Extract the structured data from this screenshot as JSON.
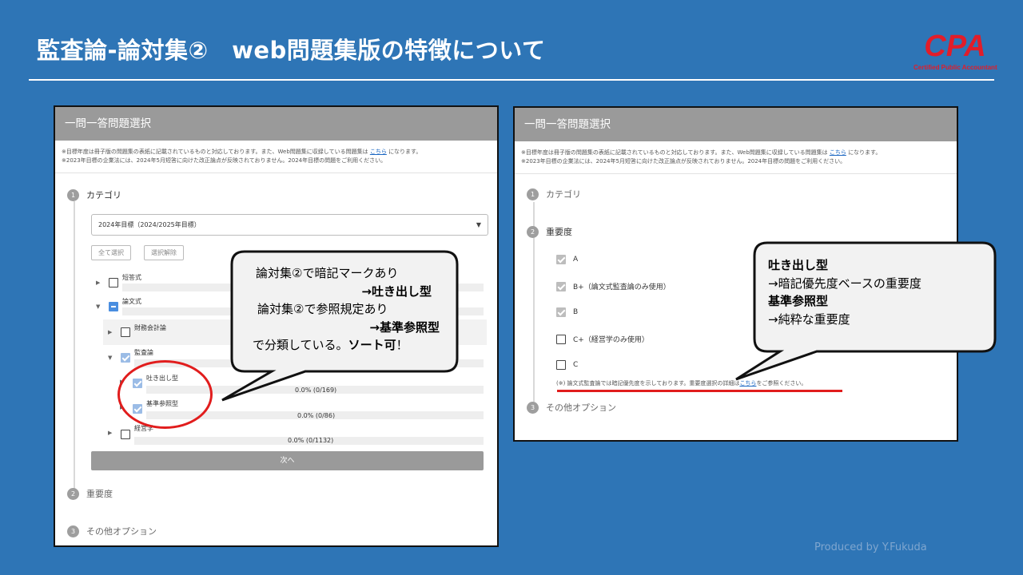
{
  "slide": {
    "title": "監査論-論対集②　web問題集版の特徴について",
    "logo_text": "CPA",
    "logo_sub": "Certified Public Accountant",
    "footer": "Produced by Y.Fukuda"
  },
  "left_panel": {
    "header": "一問一答問題選択",
    "note_line1_before": "※目標年度は冊子版の問題集の表紙に記載されているものと対応しております。また、Web問題集に収録している問題集は",
    "note_link": "こちら",
    "note_line1_after": "になります。",
    "note_line2": "※2023年目標の企業法には、2024年5月短答に向けた改正論点が反映されておりません。2024年目標の問題をご利用ください。",
    "step1": {
      "num": "1",
      "label": "カテゴリ"
    },
    "select_value": "2024年目標（2024/2025年目標）",
    "select_all": "全て選択",
    "deselect_all": "選択解除",
    "tree": {
      "short_answer": "短答式",
      "essay": "論文式",
      "financial_accounting": "財務会計論",
      "auditing": "監査論",
      "memorize_type": "吐き出し型",
      "memorize_progress": "0.0% (0/169)",
      "reference_type": "基準参照型",
      "reference_progress": "0.0% (0/86)",
      "management": "経営学",
      "management_progress": "0.0% (0/1132)"
    },
    "next_button": "次へ",
    "step2": {
      "num": "2",
      "label": "重要度"
    },
    "step3": {
      "num": "3",
      "label": "その他オプション"
    }
  },
  "right_panel": {
    "header": "一問一答問題選択",
    "step1": {
      "num": "1",
      "label": "カテゴリ"
    },
    "step2": {
      "num": "2",
      "label": "重要度"
    },
    "importance": [
      {
        "label": "A",
        "checked": true
      },
      {
        "label": "B+（論文式監査論のみ使用）",
        "checked": true
      },
      {
        "label": "B",
        "checked": true
      },
      {
        "label": "C+（経営学のみ使用）",
        "checked": false
      },
      {
        "label": "C",
        "checked": false
      }
    ],
    "imp_note_before": "(※) 論文式監査論では暗記優先度を示しております。重要度選択の詳細は",
    "imp_note_link": "こちら",
    "imp_note_after": "をご参照ください。",
    "step3": {
      "num": "3",
      "label": "その他オプション"
    }
  },
  "callout_left": {
    "line1": "論対集②で暗記マークあり",
    "line2": "→吐き出し型",
    "line3": "論対集②で参照規定あり",
    "line4": "→基準参照型",
    "line5_a": "で分類している。",
    "line5_b": "ソート可",
    "line5_c": "！"
  },
  "callout_right": {
    "line1": "吐き出し型",
    "line2": "→暗記優先度ベースの重要度",
    "line3": "基準参照型",
    "line4": "→純粋な重要度"
  },
  "colors": {
    "background": "#2e75b6",
    "panel_header": "#9a9a9a",
    "accent_red": "#e11d1d",
    "checkbox_blue": "#9bbce6"
  }
}
